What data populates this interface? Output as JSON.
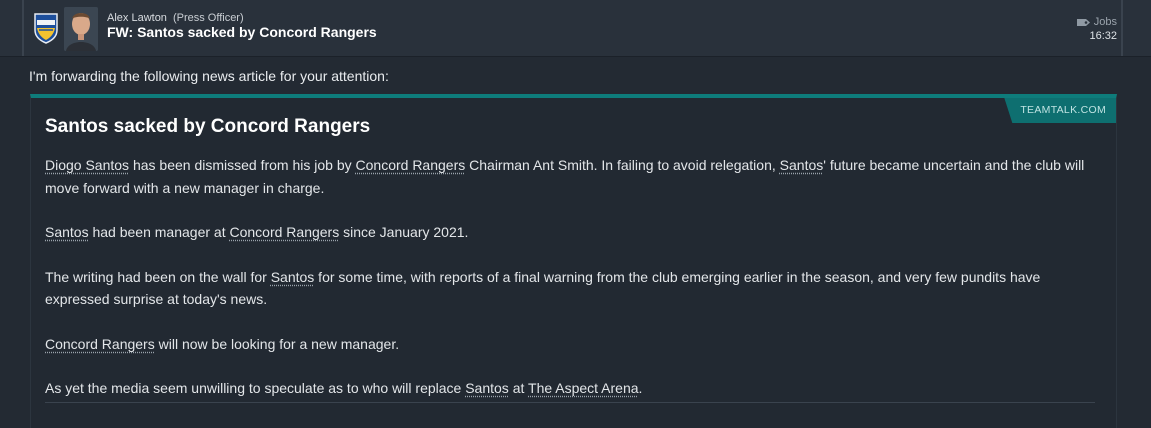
{
  "header": {
    "sender_name": "Alex Lawton",
    "sender_role": "(Press Officer)",
    "subject": "FW: Santos sacked by Concord Rangers",
    "category": "Jobs",
    "time": "16:32",
    "category_icon": "tag-icon",
    "club_badge_icon": "club-badge-icon",
    "avatar_icon": "person-avatar"
  },
  "intro": "I'm forwarding the following news article for your attention:",
  "article": {
    "source": "TEAMTALK.COM",
    "headline": "Santos sacked by Concord Rangers",
    "p1": {
      "a": "Diogo Santos",
      "b": " has been dismissed from his job by ",
      "c": "Concord Rangers",
      "d": " Chairman Ant Smith. In failing to avoid relegation, ",
      "e": "Santos",
      "f": "' future became uncertain and the club will move forward with a new manager in charge."
    },
    "p2": {
      "a": "Santos",
      "b": " had been manager at ",
      "c": "Concord Rangers",
      "d": " since January 2021."
    },
    "p3": {
      "a": "The writing had been on the wall for ",
      "b": "Santos",
      "c": " for some time, with reports of a final warning from the club emerging earlier in the season, and very few pundits have expressed surprise at today's news."
    },
    "p4": {
      "a": "Concord Rangers",
      "b": " will now be looking for a new manager."
    },
    "p5": {
      "a": "As yet the media seem unwilling to speculate as to who will replace ",
      "b": "Santos",
      "c": " at ",
      "d": "The Aspect Arena",
      "e": "."
    }
  },
  "colors": {
    "accent": "#0e7c7b",
    "background": "#232a33",
    "header": "#29313b"
  }
}
